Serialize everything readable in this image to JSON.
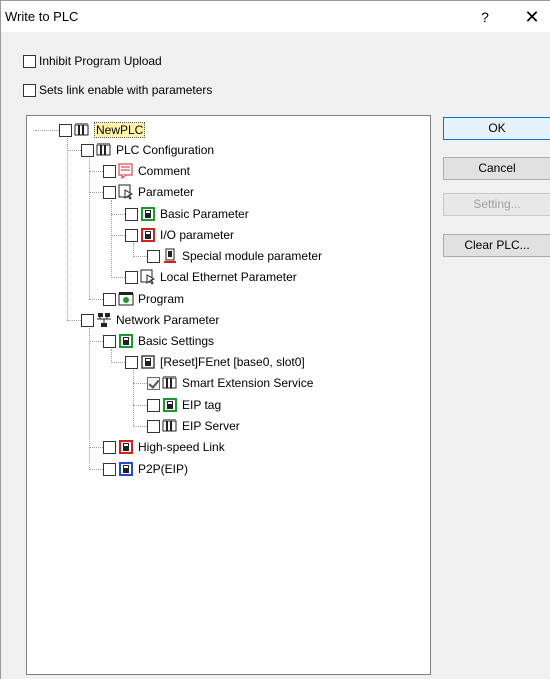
{
  "window": {
    "title": "Write to PLC",
    "help": "?",
    "close": "✕"
  },
  "options": [
    {
      "label": "Inhibit Program Upload",
      "checked": false
    },
    {
      "label": "Sets link enable with parameters",
      "checked": false
    }
  ],
  "tree": [
    {
      "label": "NewPLC",
      "icon": "plc-icon",
      "checked": false,
      "selected": true
    },
    {
      "label": "PLC Configuration",
      "icon": "plc-icon",
      "checked": false
    },
    {
      "label": "Comment",
      "icon": "comment-icon",
      "checked": false
    },
    {
      "label": "Parameter",
      "icon": "parameter-icon",
      "checked": false
    },
    {
      "label": "Basic Parameter",
      "icon": "module-icon",
      "checked": false
    },
    {
      "label": "I/O parameter",
      "icon": "io-module-icon",
      "checked": false
    },
    {
      "label": "Special module parameter",
      "icon": "special-module-icon",
      "checked": false
    },
    {
      "label": "Local Ethernet Parameter",
      "icon": "parameter-icon",
      "checked": false
    },
    {
      "label": "Program",
      "icon": "program-icon",
      "checked": false
    },
    {
      "label": "Network Parameter",
      "icon": "network-icon",
      "checked": false
    },
    {
      "label": "Basic Settings",
      "icon": "module-icon",
      "checked": false
    },
    {
      "label": "[Reset]FEnet [base0, slot0]",
      "icon": "fenet-module-icon",
      "checked": false
    },
    {
      "label": "Smart Extension Service",
      "icon": "plc-icon",
      "checked": true
    },
    {
      "label": "EIP tag",
      "icon": "module-icon",
      "checked": false
    },
    {
      "label": "EIP Server",
      "icon": "plc-icon",
      "checked": false
    },
    {
      "label": "High-speed Link",
      "icon": "hs-link-icon",
      "checked": false
    },
    {
      "label": "P2P(EIP)",
      "icon": "p2p-icon",
      "checked": false
    }
  ],
  "buttons": {
    "ok": "OK",
    "cancel": "Cancel",
    "setting": "Setting...",
    "clear_plc": "Clear PLC..."
  },
  "colors": {
    "green": "#1a9a2a",
    "red": "#d42020",
    "blue": "#1f4fc8",
    "selection": "#fff4a8"
  }
}
